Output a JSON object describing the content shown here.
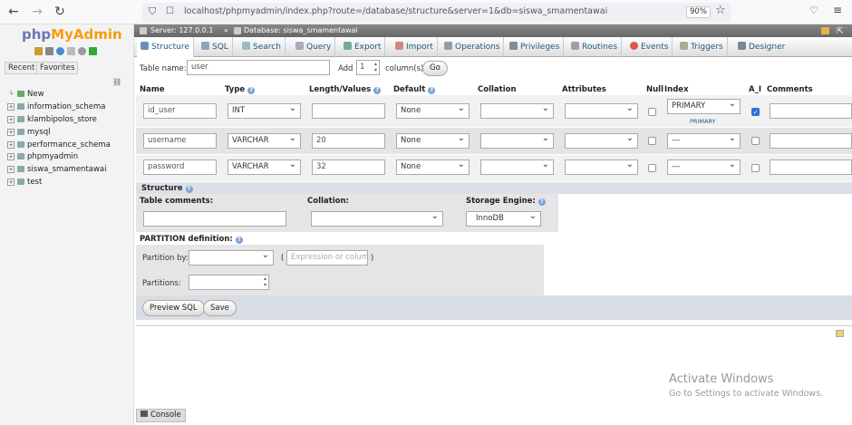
{
  "browser": {
    "url": "localhost/phpmyadmin/index.php?route=/database/structure&server=1&db=siswa_smamentawai",
    "zoom": "90%"
  },
  "sidebar": {
    "logo_php": "php",
    "logo_my": "MyAdmin",
    "recent": "Recent",
    "favorites": "Favorites",
    "items": [
      {
        "label": "New"
      },
      {
        "label": "information_schema"
      },
      {
        "label": "klambipolos_store"
      },
      {
        "label": "mysql"
      },
      {
        "label": "performance_schema"
      },
      {
        "label": "phpmyadmin"
      },
      {
        "label": "siswa_smamentawai"
      },
      {
        "label": "test"
      }
    ]
  },
  "breadcrumb": {
    "server": "Server: 127.0.0.1",
    "sep": "»",
    "database": "Database: siswa_smamentawai"
  },
  "tabs": [
    {
      "label": "Structure"
    },
    {
      "label": "SQL"
    },
    {
      "label": "Search"
    },
    {
      "label": "Query"
    },
    {
      "label": "Export"
    },
    {
      "label": "Import"
    },
    {
      "label": "Operations"
    },
    {
      "label": "Privileges"
    },
    {
      "label": "Routines"
    },
    {
      "label": "Events"
    },
    {
      "label": "Triggers"
    },
    {
      "label": "Designer"
    }
  ],
  "form": {
    "table_name_label": "Table name:",
    "table_name": "user",
    "add_label": "Add",
    "add_count": "1",
    "columns_label": "column(s)",
    "go": "Go"
  },
  "headers": {
    "name": "Name",
    "type": "Type",
    "length": "Length/Values",
    "default": "Default",
    "collation": "Collation",
    "attributes": "Attributes",
    "null": "Null",
    "index": "Index",
    "ai": "A_I",
    "comments": "Comments"
  },
  "columns": [
    {
      "name": "id_user",
      "type": "INT",
      "length": "",
      "default": "None",
      "index": "PRIMARY",
      "index_sub": "PRIMARY",
      "ai": true
    },
    {
      "name": "username",
      "type": "VARCHAR",
      "length": "20",
      "default": "None",
      "index": "---",
      "index_sub": "",
      "ai": false
    },
    {
      "name": "password",
      "type": "VARCHAR",
      "length": "32",
      "default": "None",
      "index": "---",
      "index_sub": "",
      "ai": false
    }
  ],
  "structure": {
    "title": "Structure",
    "table_comments": "Table comments:",
    "collation": "Collation:",
    "engine_label": "Storage Engine:",
    "engine": "InnoDB"
  },
  "partition": {
    "title": "PARTITION definition:",
    "by_label": "Partition by:",
    "expression_placeholder": "Expression or column list",
    "open_paren": "(",
    "close_paren": ")",
    "partitions_label": "Partitions:"
  },
  "buttons": {
    "preview": "Preview SQL",
    "save": "Save"
  },
  "watermark": {
    "line1": "Activate Windows",
    "line2": "Go to Settings to activate Windows."
  },
  "console": "Console"
}
